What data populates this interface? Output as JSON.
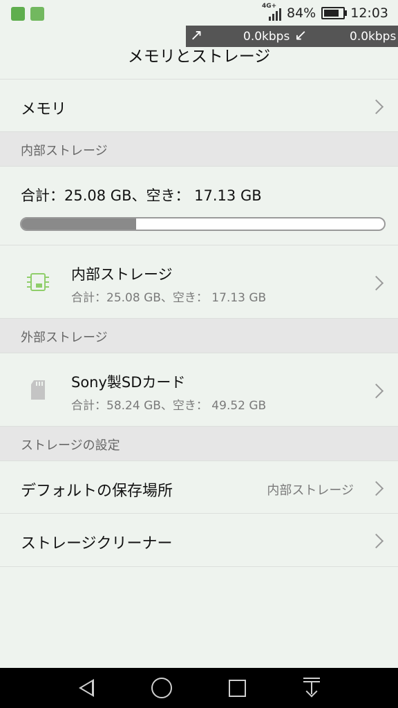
{
  "status_bar": {
    "network_type": "4G+",
    "battery_percent": "84%",
    "battery_level": 0.84,
    "time": "12:03",
    "net_speed_up": "0.0kbps",
    "net_speed_down": "0.0kbps",
    "icons": [
      "sim-card-icon",
      "app-notification-icon",
      "signal-icon",
      "battery-icon"
    ]
  },
  "header": {
    "title": "メモリとストレージ"
  },
  "memory": {
    "label": "メモリ"
  },
  "internal": {
    "section_label": "内部ストレージ",
    "summary": "合計：25.08 GB、空き： 17.13 GB",
    "used_fraction": 0.317,
    "item": {
      "title": "内部ストレージ",
      "subtitle": "合計：25.08 GB、空き： 17.13 GB",
      "icon": "chip-icon",
      "icon_color": "#8fce6a"
    }
  },
  "external": {
    "section_label": "外部ストレージ",
    "item": {
      "title": "Sony製SDカード",
      "subtitle": "合計：58.24 GB、空き： 49.52 GB",
      "icon": "sd-card-icon"
    }
  },
  "settings": {
    "section_label": "ストレージの設定",
    "default_location_label": "デフォルトの保存場所",
    "default_location_value": "内部ストレージ",
    "cleaner_label": "ストレージクリーナー"
  },
  "nav_bar": {
    "buttons": [
      "back-icon",
      "home-icon",
      "recents-icon",
      "notification-shade-icon"
    ]
  },
  "colors": {
    "background": "#eef3ee",
    "section_bg": "#e6e6e6",
    "progress_used": "#8a8a8a",
    "accent_green": "#8fce6a"
  }
}
